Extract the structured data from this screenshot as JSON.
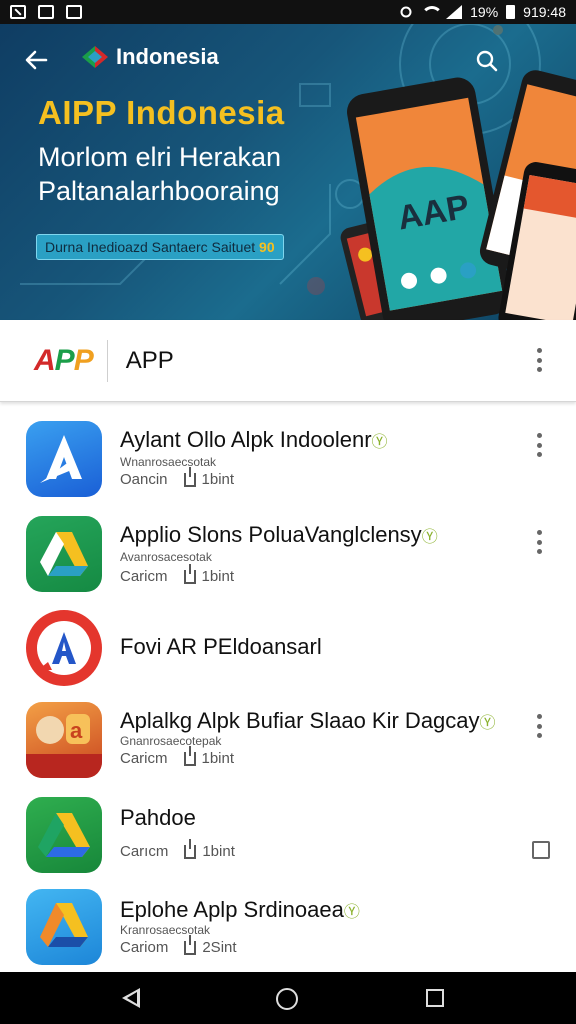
{
  "status_bar": {
    "battery_text": "19%",
    "time": "919:48"
  },
  "banner": {
    "brand": "Indonesia",
    "title": "AIPP Indonesia",
    "subtitle_line1": "Morlom elri Herakan",
    "subtitle_line2": "Paltanalarhbooraing",
    "badge_text": "Durna Inedioazd Santaerc Saituet",
    "badge_highlight": "90",
    "phone_screen_text": "AAP",
    "colors": {
      "accent": "#f5c020",
      "background": "#17567a"
    }
  },
  "app_header": {
    "logo_text": "APP",
    "title": "APP"
  },
  "apps": [
    {
      "title": "Aylant Ollo Alpk Indoolenr",
      "suffix": "Ⓨ",
      "subtitle": "Wnanrosaecsotak",
      "meta_left": "Oancin",
      "meta_right": "1bint",
      "icon": "drive-a-blue-icon",
      "action": "more"
    },
    {
      "title": "Applio Slons PoluaVanglclensy",
      "suffix": "Ⓨ",
      "subtitle": "Avanrosacesotak",
      "meta_left": "Caricm",
      "meta_right": "1bint",
      "icon": "drive-green-icon",
      "action": "more"
    },
    {
      "title": "Fovi AR PEldoansarl",
      "suffix": "",
      "subtitle": "",
      "meta_left": "",
      "meta_right": "",
      "icon": "red-a-icon",
      "action": "none"
    },
    {
      "title": "Aplalkg Alpk Bufiar Slaao Kir Dagcay",
      "suffix": "Ⓨ",
      "subtitle": "Gnanrosaecotepak",
      "meta_left": "Caricm",
      "meta_right": "1bint",
      "icon": "wayang-icon",
      "action": "more"
    },
    {
      "title": "Pahdoe",
      "suffix": "",
      "subtitle": "",
      "meta_left": "Carıcm",
      "meta_right": "1bint",
      "icon": "drive-triangle-icon",
      "action": "checkbox"
    },
    {
      "title": "Eplohe Aplp Srdinoaea",
      "suffix": "Ⓨ",
      "subtitle": "Kranrosaecsotak",
      "meta_left": "Cariom",
      "meta_right": "2Sint",
      "icon": "drive-blue-triangle-icon",
      "action": "none"
    }
  ],
  "nav": {
    "back": "back-icon",
    "home": "home-icon",
    "recents": "recents-icon"
  }
}
